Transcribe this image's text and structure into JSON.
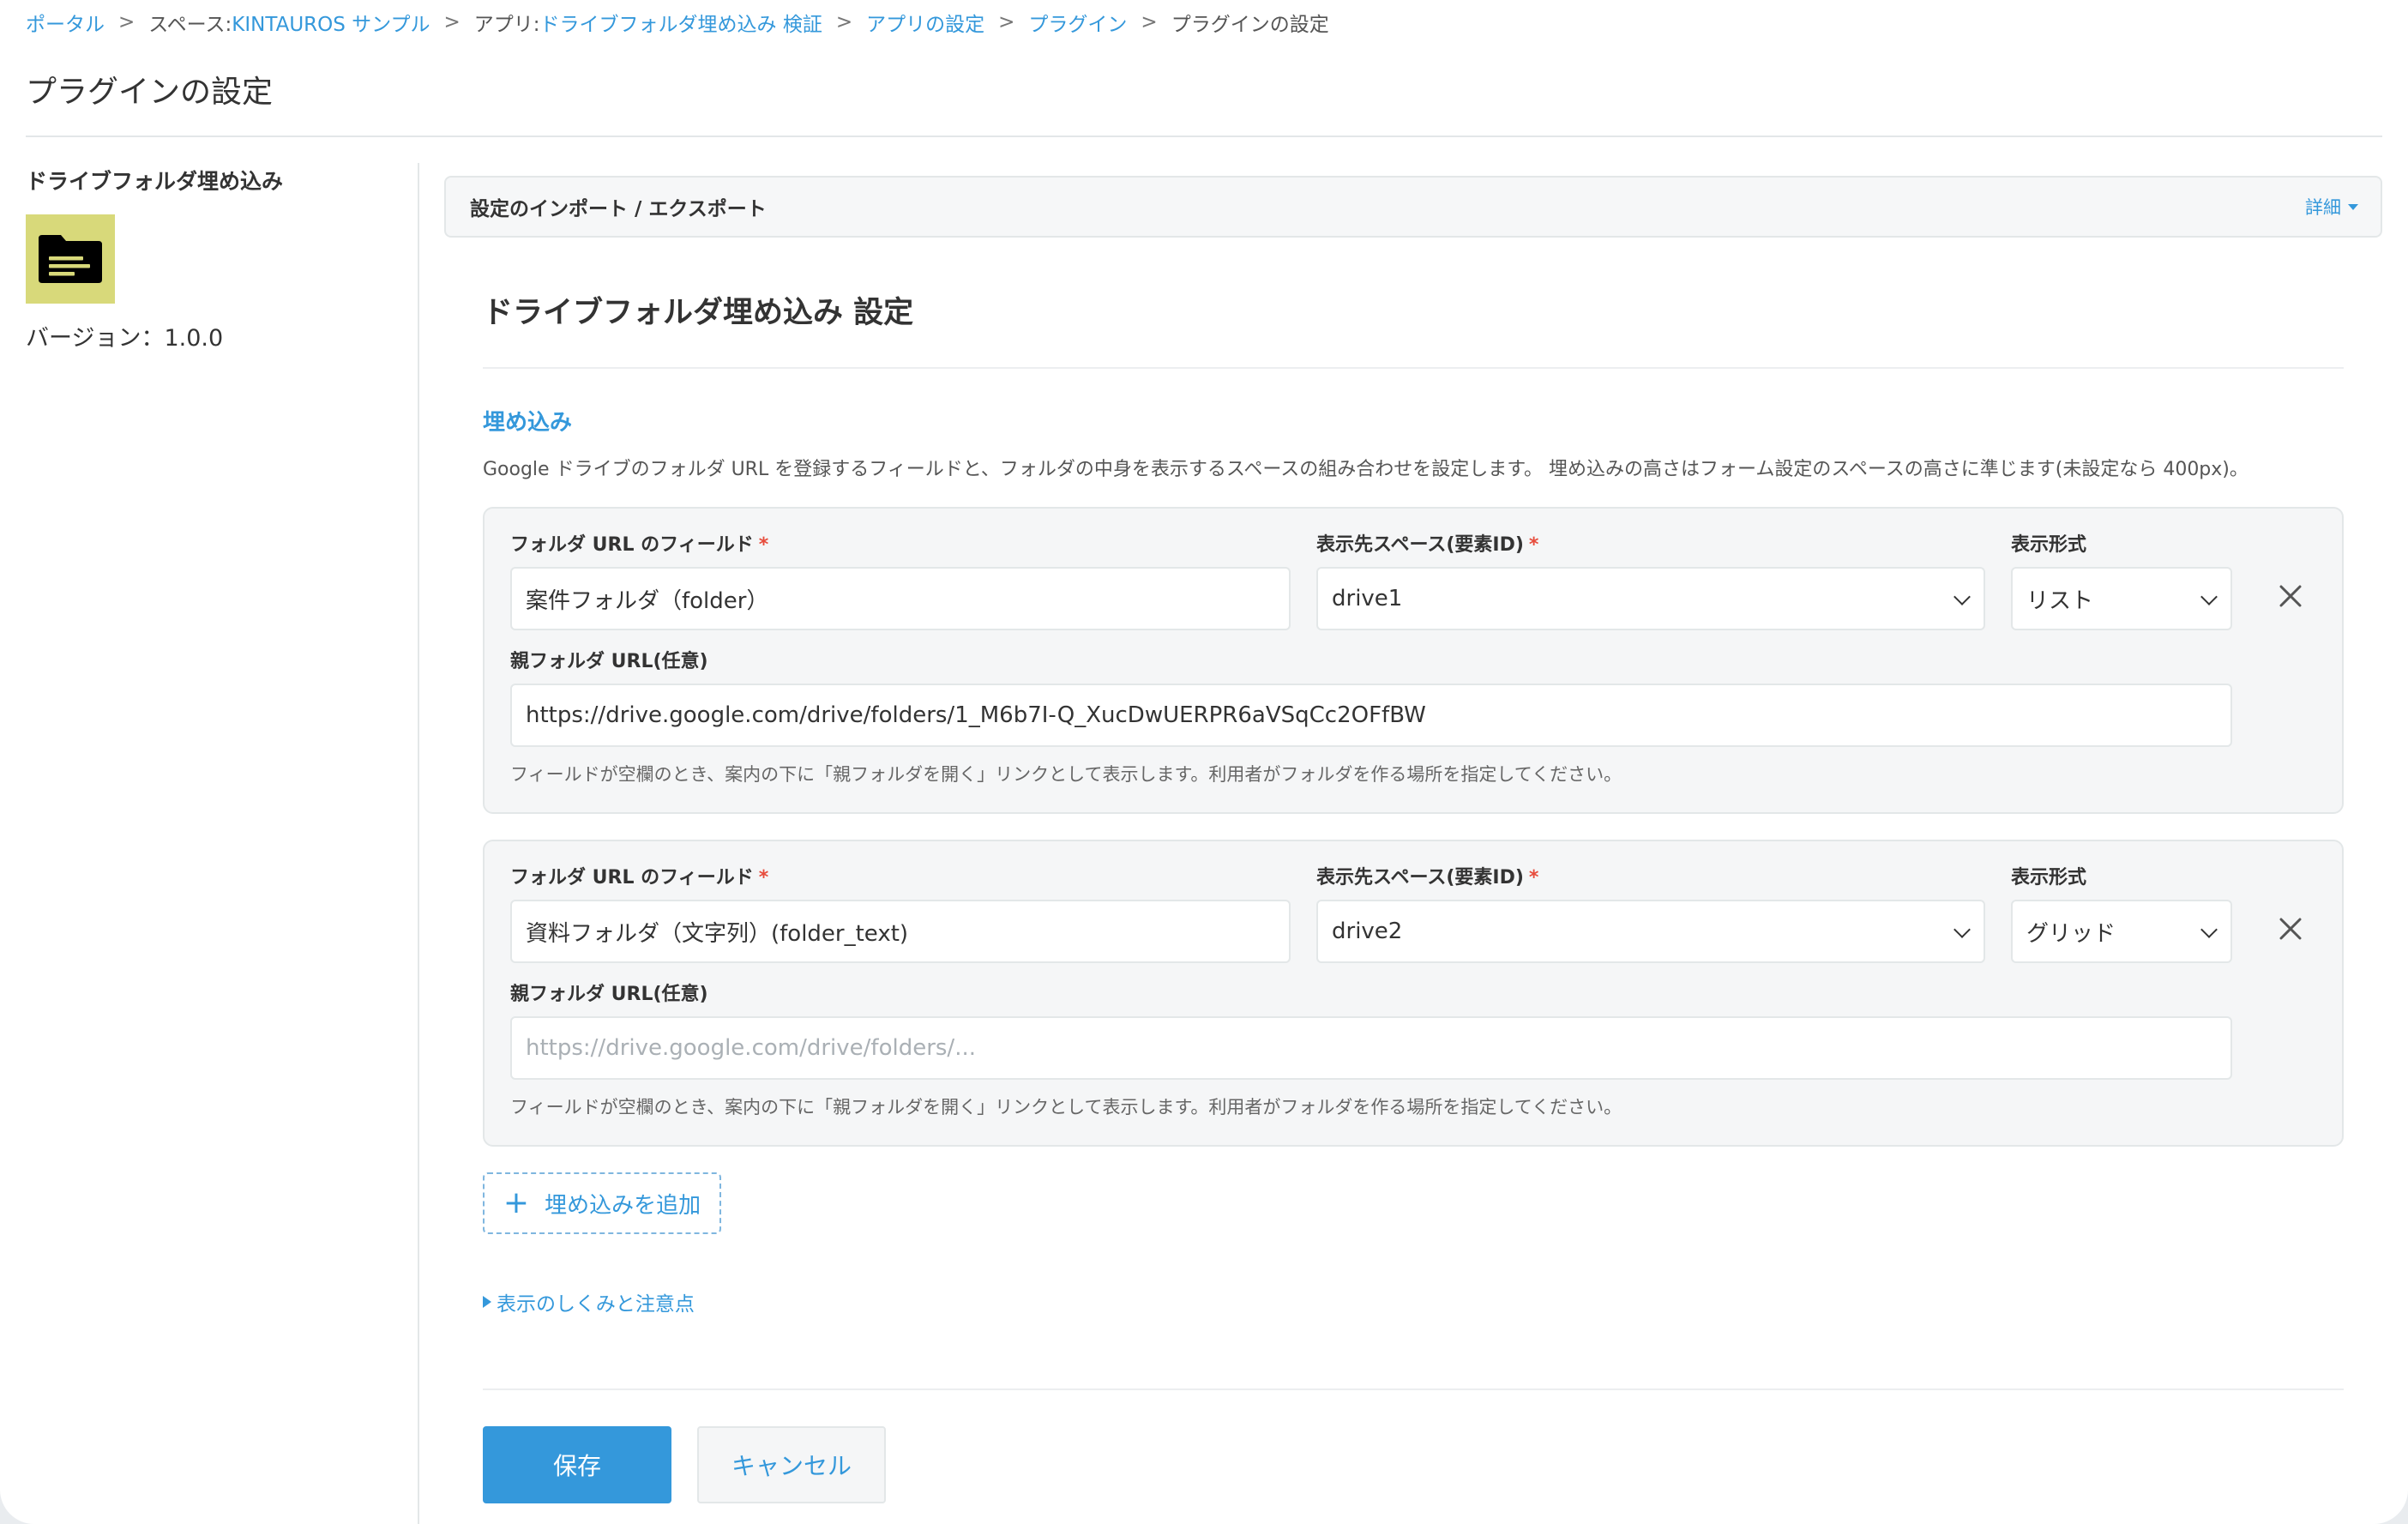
{
  "breadcrumb": {
    "portal": "ポータル",
    "space_prefix": "スペース: ",
    "space": "KINTAUROS サンプル",
    "app_prefix": "アプリ: ",
    "app": "ドライブフォルダ埋め込み 検証",
    "app_settings": "アプリの設定",
    "plugins": "プラグイン",
    "current": "プラグインの設定",
    "separator": ">"
  },
  "page_title": "プラグインの設定",
  "sidebar": {
    "plugin_name": "ドライブフォルダ埋め込み",
    "icon": "folder-icon",
    "icon_bg": "#d8d97a",
    "version": "バージョン：1.0.0"
  },
  "import_export": {
    "title": "設定のインポート / エクスポート",
    "details_link": "詳細"
  },
  "settings": {
    "title": "ドライブフォルダ埋め込み 設定",
    "section_title": "埋め込み",
    "section_desc": "Google ドライブのフォルダ URL を登録するフィールドと、フォルダの中身を表示するスペースの組み合わせを設定します。 埋め込みの高さはフォーム設定のスペースの高さに準じます(未設定なら 400px)。",
    "labels": {
      "folder_field": "フォルダ URL のフィールド",
      "space": "表示先スペース(要素ID)",
      "format": "表示形式",
      "parent_url": "親フォルダ URL(任意)",
      "required_mark": "*"
    },
    "hint": "フィールドが空欄のとき、案内の下に「親フォルダを開く」リンクとして表示します。利用者がフォルダを作る場所を指定してください。",
    "embeds": [
      {
        "folder_field": "案件フォルダ（folder）",
        "space": "drive1",
        "format": "リスト",
        "parent_url": "https://drive.google.com/drive/folders/1_M6b7I-Q_XucDwUERPR6aVSqCc2OFfBW",
        "parent_placeholder": ""
      },
      {
        "folder_field": "資料フォルダ（文字列）(folder_text)",
        "space": "drive2",
        "format": "グリッド",
        "parent_url": "",
        "parent_placeholder": "https://drive.google.com/drive/folders/..."
      }
    ],
    "add_button": "埋め込みを追加",
    "details_toggle": "表示のしくみと注意点"
  },
  "actions": {
    "save": "保存",
    "cancel": "キャンセル"
  },
  "colors": {
    "accent": "#3498db",
    "required": "#e74c3c"
  }
}
